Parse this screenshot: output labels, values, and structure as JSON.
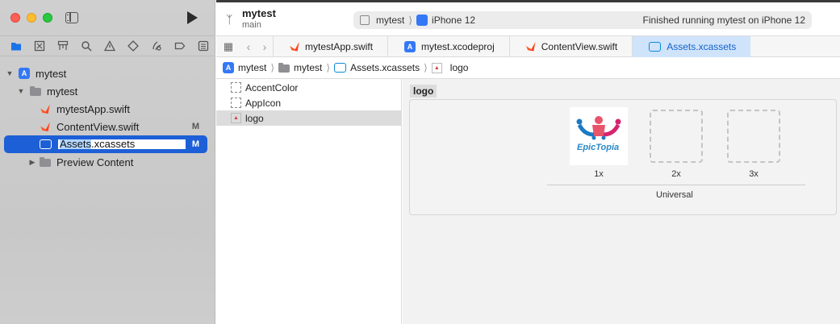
{
  "toolbar": {
    "project_name": "mytest",
    "branch": "main",
    "scheme_name": "mytest",
    "destination": "iPhone 12",
    "status": "Finished running mytest on iPhone 12"
  },
  "tabs": [
    {
      "label": "mytestApp.swift"
    },
    {
      "label": "mytest.xcodeproj"
    },
    {
      "label": "ContentView.swift"
    },
    {
      "label": "Assets.xcassets"
    }
  ],
  "jumpbar": [
    "mytest",
    "mytest",
    "Assets.xcassets",
    "logo"
  ],
  "navigator": {
    "root": "mytest",
    "group": "mytest",
    "files": [
      {
        "label": "mytestApp.swift",
        "badge": ""
      },
      {
        "label": "ContentView.swift",
        "badge": "M"
      }
    ],
    "renaming": {
      "selected_part": "Assets",
      "rest": ".xcassets",
      "badge": "M"
    },
    "preview": "Preview Content"
  },
  "asset_list": [
    "AccentColor",
    "AppIcon",
    "logo"
  ],
  "asset_detail": {
    "set_name": "logo",
    "scales": [
      "1x",
      "2x",
      "3x"
    ],
    "group_label": "Universal",
    "image_text": "EpicTopia"
  }
}
